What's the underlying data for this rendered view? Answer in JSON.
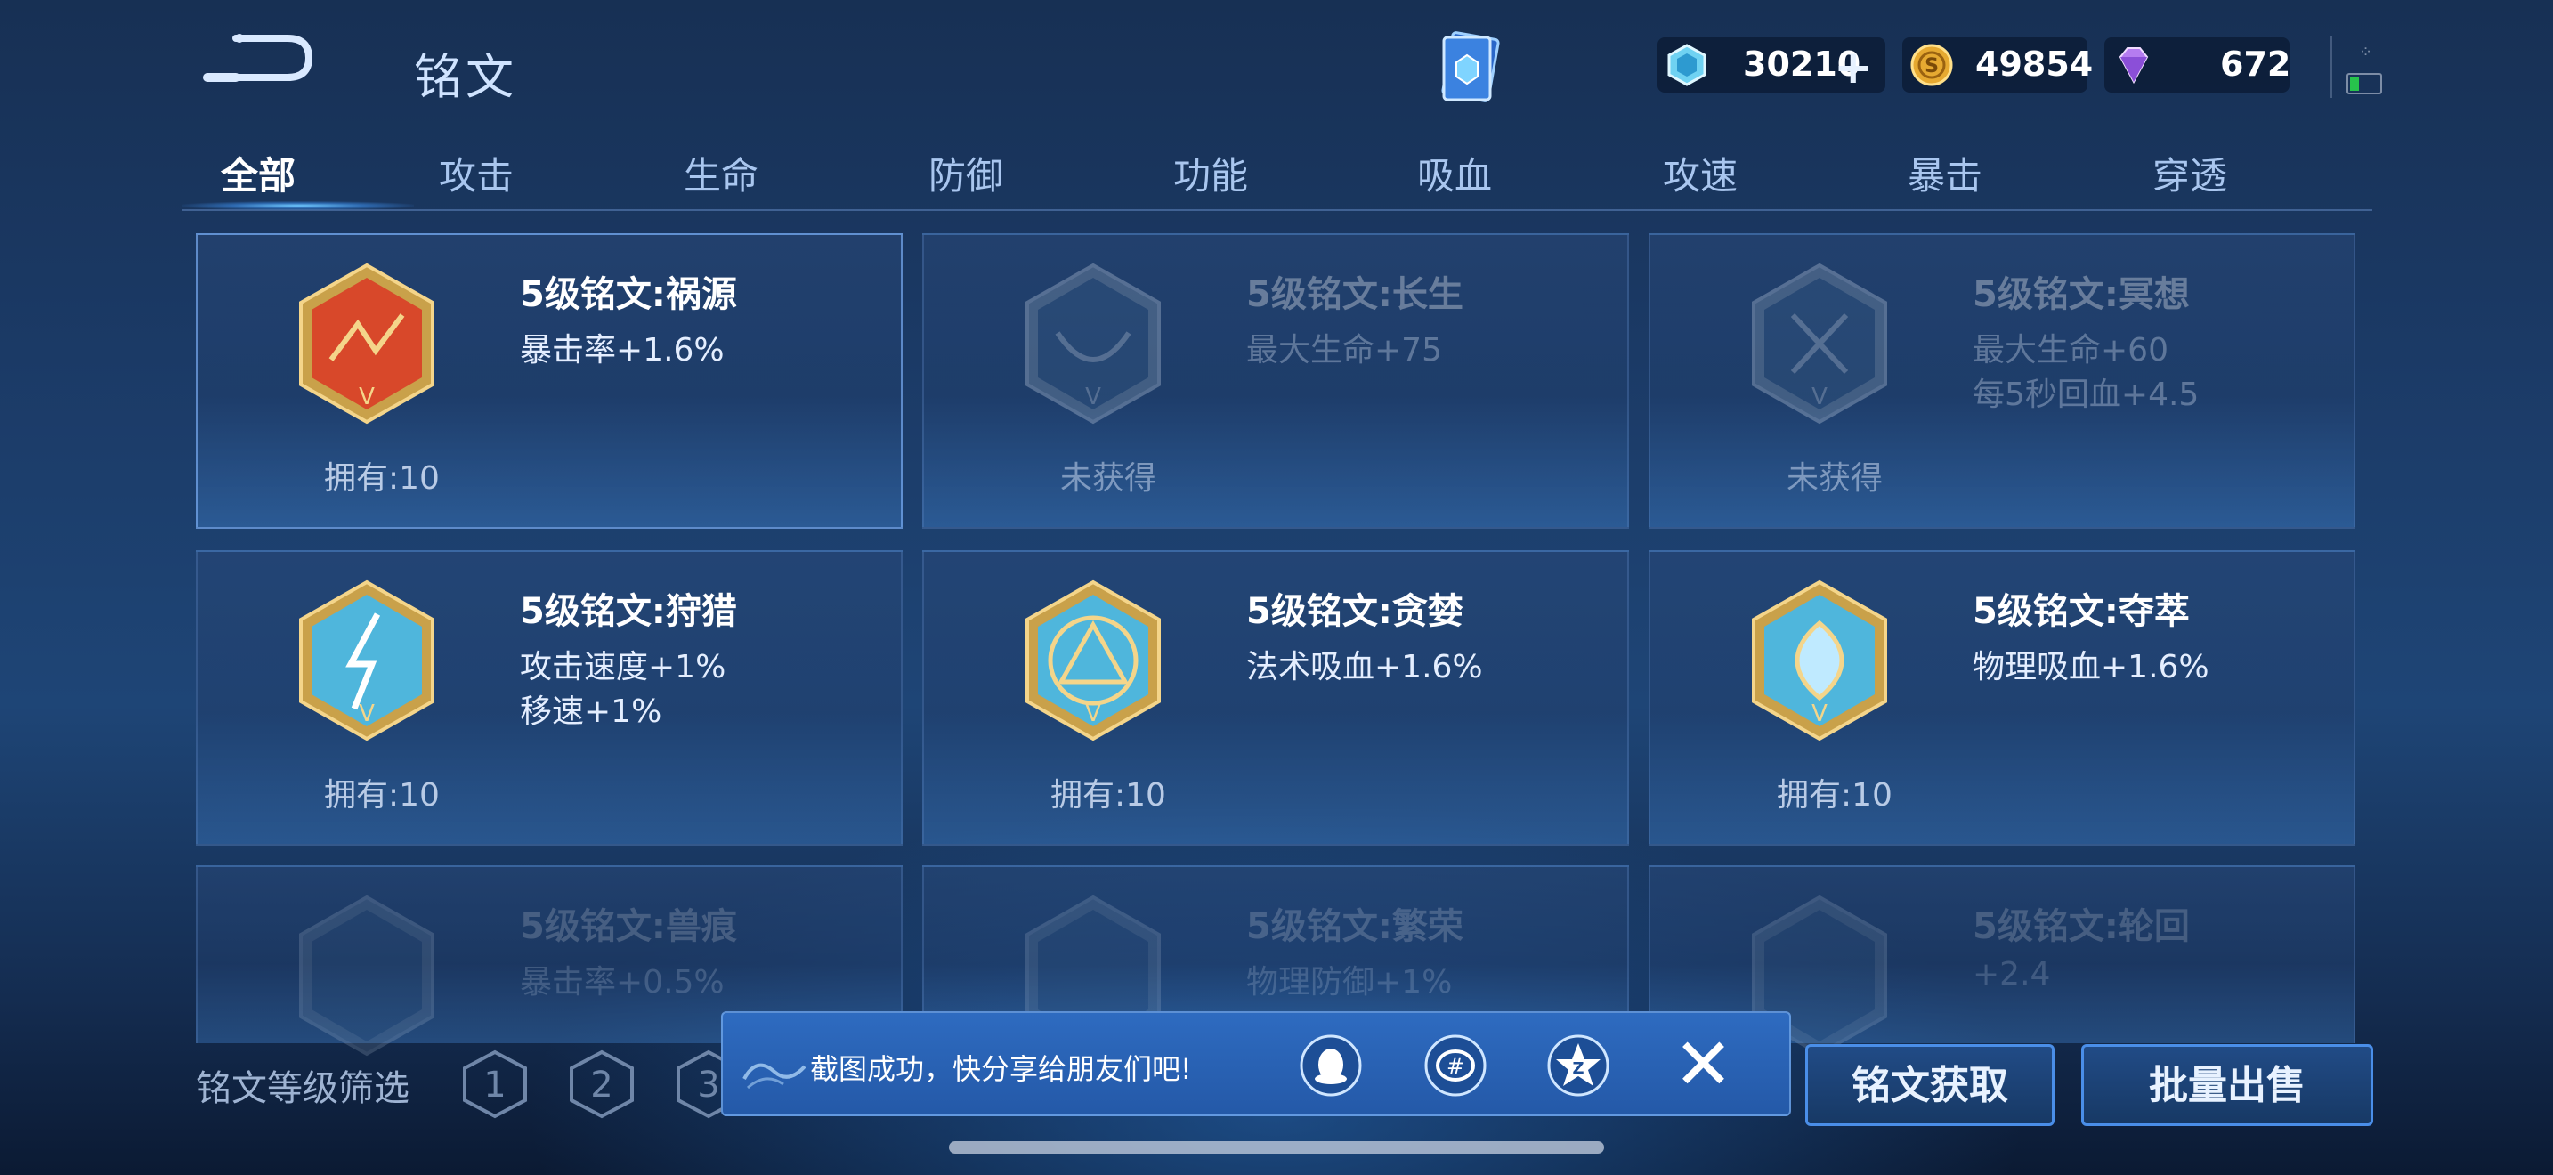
{
  "header": {
    "title": "铭文",
    "currencies": [
      {
        "icon": "ice-crystal-icon",
        "value": "30210",
        "has_plus": true
      },
      {
        "icon": "gold-coin-icon",
        "value": "49854",
        "has_plus": false
      },
      {
        "icon": "diamond-icon",
        "value": "672",
        "has_plus": false
      }
    ]
  },
  "tabs": [
    "全部",
    "攻击",
    "生命",
    "防御",
    "功能",
    "吸血",
    "攻速",
    "暴击",
    "穿透"
  ],
  "active_tab": "全部",
  "inscriptions": [
    {
      "name": "5级铭文:祸源",
      "stats": [
        "暴击率+1.6%"
      ],
      "owned": "拥有:10",
      "color": "#d8482a"
    },
    {
      "name": "5级铭文:长生",
      "stats": [
        "最大生命+75"
      ],
      "owned": "未获得",
      "color": "#5a7fa8"
    },
    {
      "name": "5级铭文:冥想",
      "stats": [
        "最大生命+60",
        "每5秒回血+4.5"
      ],
      "owned": "未获得",
      "color": "#5a7fa8"
    },
    {
      "name": "5级铭文:狩猎",
      "stats": [
        "攻击速度+1%",
        "移速+1%"
      ],
      "owned": "拥有:10",
      "color": "#4fb6dc"
    },
    {
      "name": "5级铭文:贪婪",
      "stats": [
        "法术吸血+1.6%"
      ],
      "owned": "拥有:10",
      "color": "#4fb6dc"
    },
    {
      "name": "5级铭文:夺萃",
      "stats": [
        "物理吸血+1.6%"
      ],
      "owned": "拥有:10",
      "color": "#4fb6dc"
    },
    {
      "name": "5级铭文:兽痕",
      "stats": [
        "暴击率+0.5%"
      ],
      "owned": "",
      "color": "#5a7fa8"
    },
    {
      "name": "5级铭文:繁荣",
      "stats": [
        "物理防御+1%"
      ],
      "owned": "",
      "color": "#5a7fa8"
    },
    {
      "name": "5级铭文:轮回",
      "stats": [
        "+2.4"
      ],
      "owned": "",
      "color": "#5a7fa8"
    }
  ],
  "bottom": {
    "filter_label": "铭文等级筛选",
    "levels": [
      "1",
      "2",
      "3"
    ],
    "acquire_button": "铭文获取",
    "sell_button": "批量出售"
  },
  "toast": {
    "message": "截图成功，快分享给朋友们吧!",
    "share_targets": [
      "qq-icon",
      "wechat-icon",
      "qzone-icon"
    ],
    "close": "✕"
  }
}
